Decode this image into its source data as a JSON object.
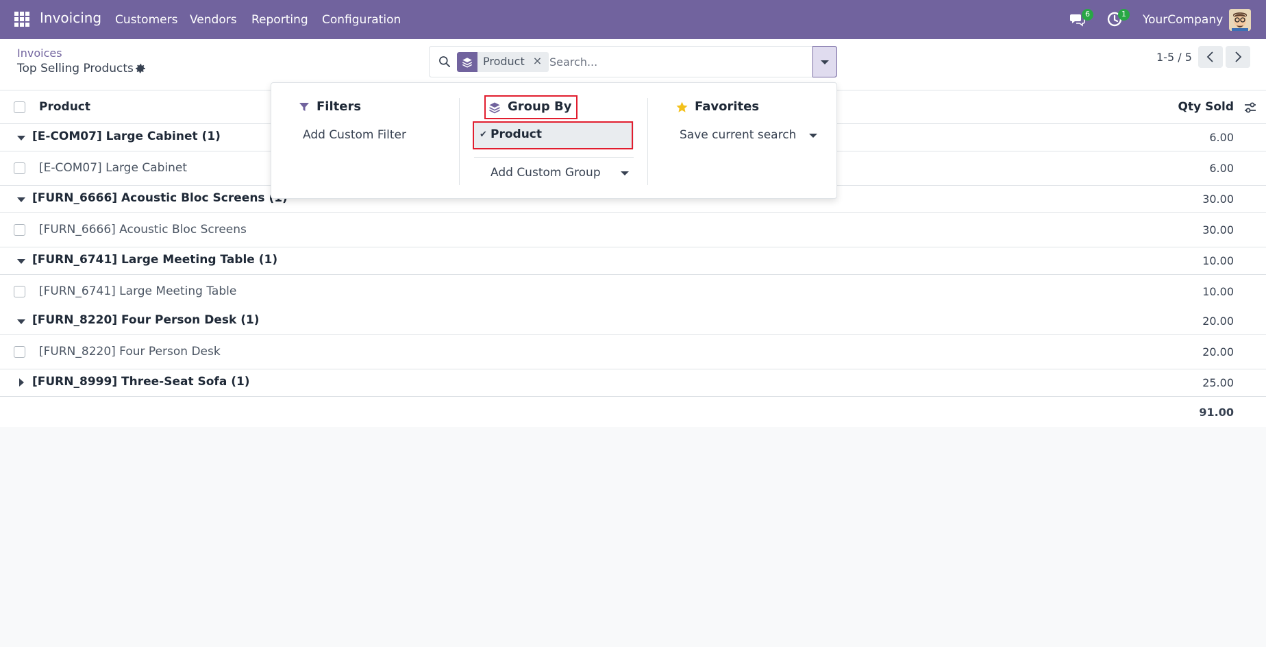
{
  "navbar": {
    "app_name": "Invoicing",
    "menu": [
      "Customers",
      "Vendors",
      "Reporting",
      "Configuration"
    ],
    "messages_count": "6",
    "activities_count": "1",
    "company": "YourCompany"
  },
  "control_panel": {
    "breadcrumb": "Invoices",
    "title": "Top Selling Products",
    "pager": "1-5 / 5"
  },
  "search": {
    "facet_label": "Product",
    "facet_remove": "×",
    "placeholder": "Search..."
  },
  "dropdown": {
    "filters_title": "Filters",
    "add_custom_filter": "Add Custom Filter",
    "groupby_title": "Group By",
    "groupby_option": "Product",
    "groupby_check": "✔",
    "add_custom_group": "Add Custom Group",
    "favorites_title": "Favorites",
    "save_current_search": "Save current search"
  },
  "list": {
    "columns": {
      "product": "Product",
      "qty": "Qty Sold"
    },
    "groups": [
      {
        "label": "[E-COM07] Large Cabinet (1)",
        "qty": "6.00",
        "expanded": true,
        "record": {
          "label": "[E-COM07] Large Cabinet",
          "qty": "6.00"
        }
      },
      {
        "label": "[FURN_6666] Acoustic Bloc Screens (1)",
        "qty": "30.00",
        "expanded": true,
        "record": {
          "label": "[FURN_6666] Acoustic Bloc Screens",
          "qty": "30.00"
        }
      },
      {
        "label": "[FURN_6741] Large Meeting Table (1)",
        "qty": "10.00",
        "expanded": true,
        "record": {
          "label": "[FURN_6741] Large Meeting Table",
          "qty": "10.00"
        }
      },
      {
        "label": "[FURN_8220] Four Person Desk (1)",
        "qty": "20.00",
        "expanded": true,
        "record": {
          "label": "[FURN_8220] Four Person Desk",
          "qty": "20.00"
        }
      },
      {
        "label": "[FURN_8999] Three-Seat Sofa (1)",
        "qty": "25.00",
        "expanded": false
      }
    ],
    "total": "91.00"
  },
  "colors": {
    "brand": "#71639e",
    "highlight": "#e11d2e",
    "badge": "#28a745"
  }
}
